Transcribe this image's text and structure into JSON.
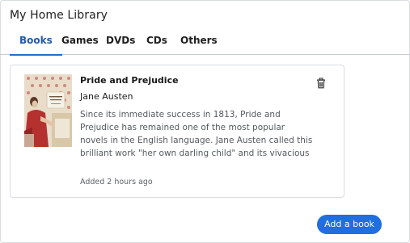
{
  "app": {
    "title": "My Home Library"
  },
  "tabs": [
    {
      "label": "Books",
      "active": true
    },
    {
      "label": "Games",
      "active": false
    },
    {
      "label": "DVDs",
      "active": false
    },
    {
      "label": "CDs",
      "active": false
    },
    {
      "label": "Others",
      "active": false
    }
  ],
  "book": {
    "title": "Pride and Prejudice",
    "author": "Jane Austen",
    "description": "Since its immediate success in 1813, Pride and Prejudice has remained one of the most popular novels in the English language. Jane Austen called this brilliant work \"her own darling child\" and its vivacious heroine, Elizabeth Bennet, \"as delightful a creature as…",
    "added": "Added 2 hours ago",
    "delete_icon": "trash-icon"
  },
  "actions": {
    "add_label": "Add a book"
  },
  "colors": {
    "accent": "#1f6fe0",
    "active_tab_text": "#1f5ba8"
  }
}
